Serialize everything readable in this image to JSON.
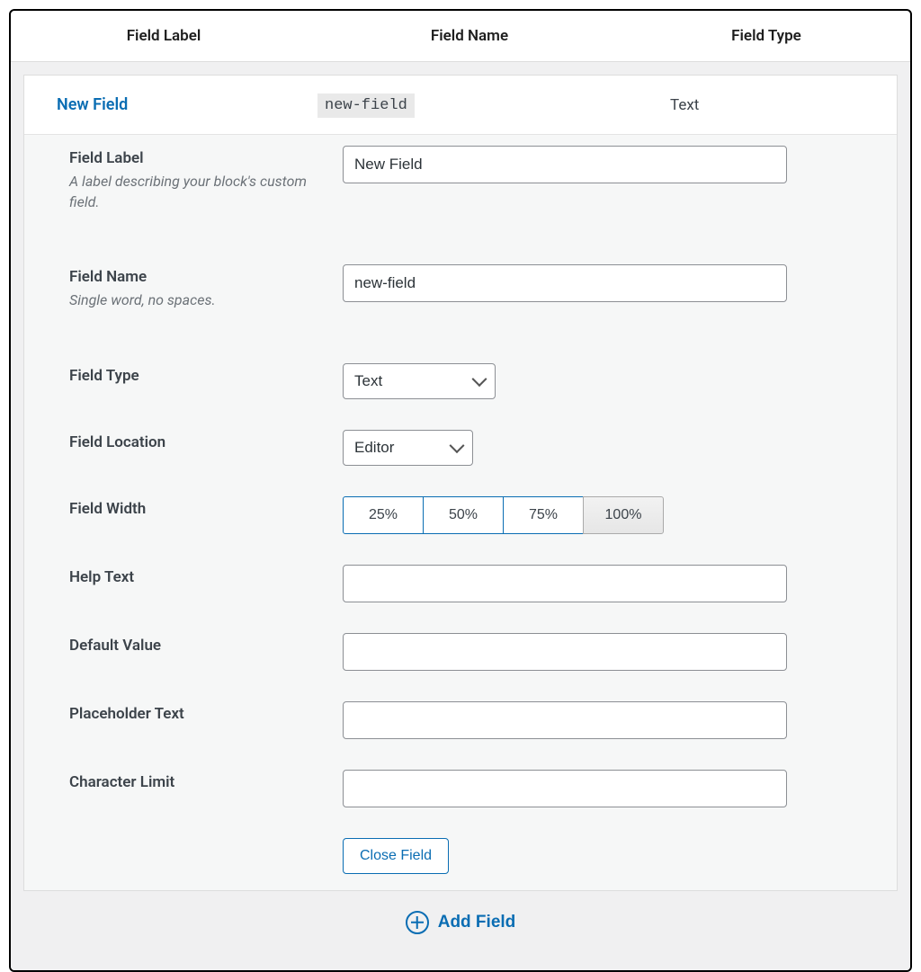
{
  "headers": {
    "label": "Field Label",
    "name": "Field Name",
    "type": "Field Type"
  },
  "summary": {
    "label": "New Field",
    "name": "new-field",
    "type": "Text"
  },
  "form": {
    "field_label": {
      "title": "Field Label",
      "desc": "A label describing your block's custom field.",
      "value": "New Field"
    },
    "field_name": {
      "title": "Field Name",
      "desc": "Single word, no spaces.",
      "value": "new-field"
    },
    "field_type": {
      "title": "Field Type",
      "value": "Text"
    },
    "field_location": {
      "title": "Field Location",
      "value": "Editor"
    },
    "field_width": {
      "title": "Field Width",
      "options": [
        "25%",
        "50%",
        "75%",
        "100%"
      ],
      "selected": "100%"
    },
    "help_text": {
      "title": "Help Text",
      "value": ""
    },
    "default_value": {
      "title": "Default Value",
      "value": ""
    },
    "placeholder_text": {
      "title": "Placeholder Text",
      "value": ""
    },
    "character_limit": {
      "title": "Character Limit",
      "value": ""
    },
    "close_field": "Close Field"
  },
  "footer": {
    "add_field": "Add Field"
  }
}
